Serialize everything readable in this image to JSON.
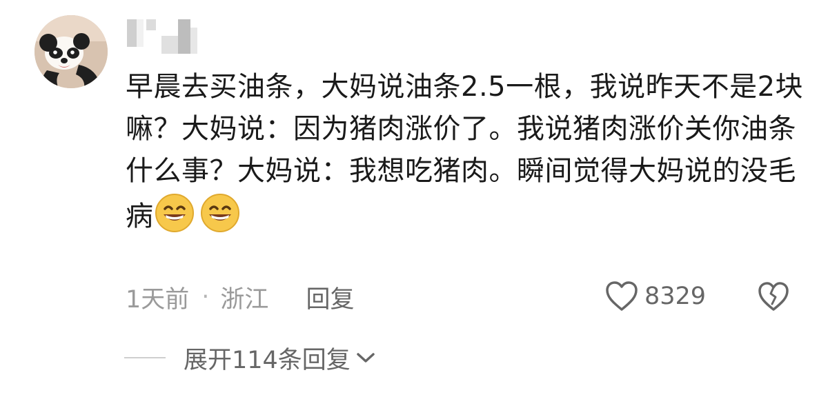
{
  "comment": {
    "text": "早晨去买油条，大妈说油条2.5一根，我说昨天不是2块嘛？大妈说：因为猪肉涨价了。我说猪肉涨价关你油条什么事？大妈说：我想吃猪肉。瞬间觉得大妈说的没毛病",
    "time": "1天前",
    "separator": "·",
    "location": "浙江",
    "reply_label": "回复",
    "like_count": "8329",
    "expand_label": "展开114条回复",
    "emojis": [
      "grinning-face-emoji",
      "grinning-face-emoji"
    ],
    "icons": {
      "avatar": "panda-avatar",
      "username": "pixelated-username",
      "like": "heart-outline-icon",
      "dislike": "broken-heart-icon",
      "expand": "chevron-down-icon"
    }
  }
}
